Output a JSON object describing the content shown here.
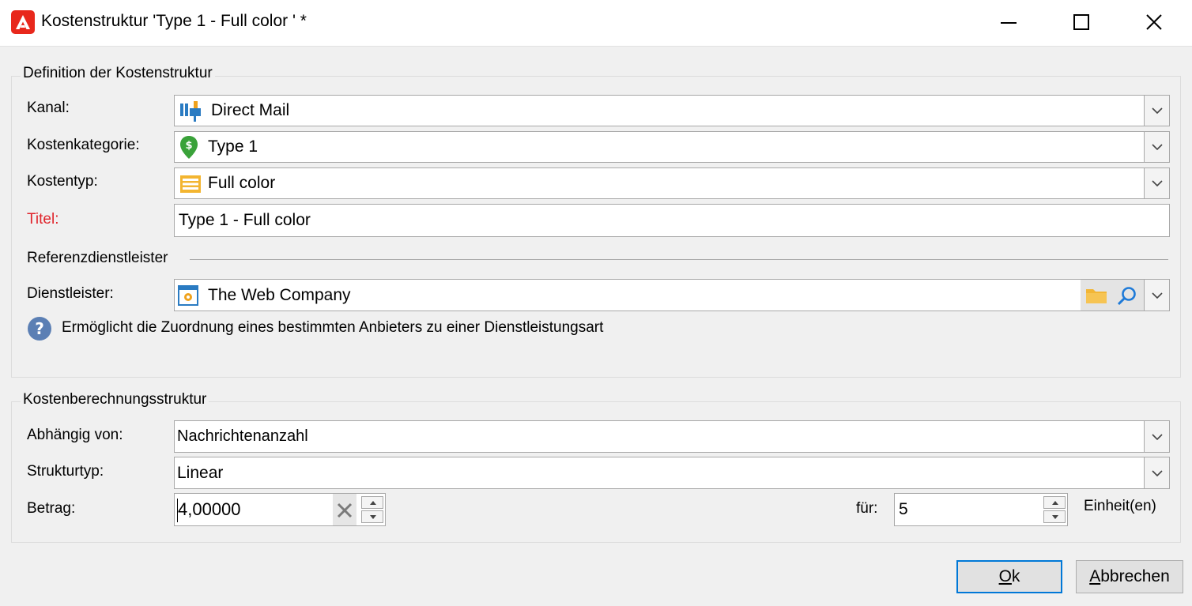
{
  "window": {
    "title": "Kostenstruktur 'Type 1 - Full color ' *",
    "controls": [
      "minimize-icon",
      "maximize-icon",
      "close-icon"
    ]
  },
  "definition": {
    "legend": "Definition der Kostenstruktur",
    "kanal": {
      "label": "Kanal:",
      "value": "Direct Mail",
      "icon": "direct-mail-icon"
    },
    "kategorie": {
      "label": "Kostenkategorie:",
      "value": "Type 1",
      "icon": "cost-category-icon"
    },
    "typ": {
      "label": "Kostentyp:",
      "value": "Full color",
      "icon": "cost-type-icon"
    },
    "titel": {
      "label": "Titel:",
      "value": "Type 1 - Full color"
    },
    "reference_section": "Referenzdienstleister",
    "dienstleister": {
      "label": "Dienstleister:",
      "value": "The Web Company",
      "icon": "provider-icon"
    },
    "help_text": "Ermöglicht die Zuordnung eines bestimmten Anbieters zu einer Dienstleistungsart"
  },
  "calculation": {
    "legend": "Kostenberechnungsstruktur",
    "abhaengig": {
      "label": "Abhängig von:",
      "value": "Nachrichtenanzahl"
    },
    "strukturtyp": {
      "label": "Strukturtyp:",
      "value": "Linear"
    },
    "betrag": {
      "label": "Betrag:",
      "value": "4,00000"
    },
    "fuer": {
      "label": "für:",
      "value": "5"
    },
    "einheit": "Einheit(en)"
  },
  "buttons": {
    "ok": {
      "mnemonic": "O",
      "rest": "k"
    },
    "cancel": {
      "mnemonic": "A",
      "rest": "bbrechen"
    }
  },
  "colors": {
    "required_label": "#e0242b",
    "default_button_border": "#0078d7",
    "app_icon": "#e8281c",
    "dialog_bg": "#f0f0f0"
  }
}
